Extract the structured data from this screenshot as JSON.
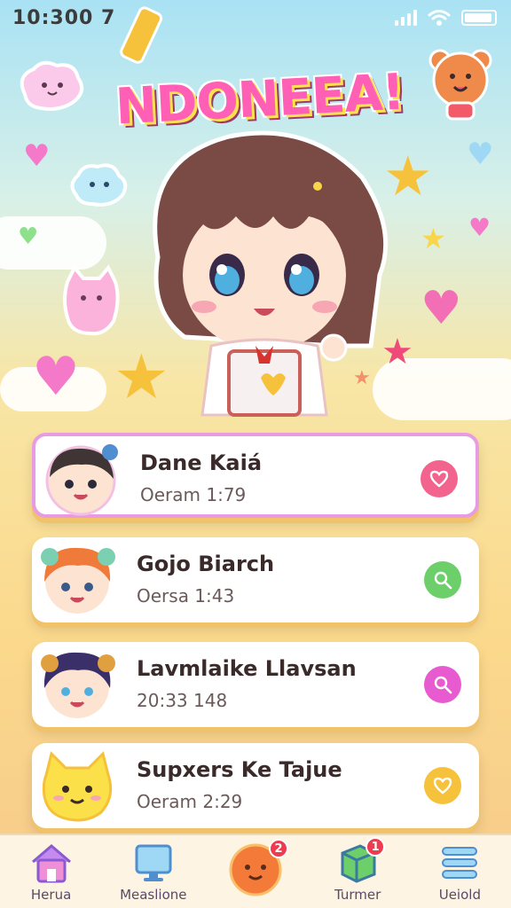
{
  "status": {
    "time": "10:300 7"
  },
  "hero": {
    "title": "NDONEEA!"
  },
  "colors": {
    "pink": "#ff5fb4",
    "green": "#6ccf6a",
    "magenta": "#e85bd0",
    "yellow": "#f7c23b"
  },
  "cards": [
    {
      "name": "Dane Kaiá",
      "time": "Oeram 1:79",
      "action_icon": "heart-icon",
      "action_color": "#f2648e"
    },
    {
      "name": "Gojo Biarch",
      "time": "Oersa 1:43",
      "action_icon": "search-icon",
      "action_color": "#6ccf6a"
    },
    {
      "name": "Lavmlaike Llavsan",
      "time": "20:33 148",
      "action_icon": "search-icon",
      "action_color": "#e85bd0"
    },
    {
      "name": "Supxers Ke Tajue",
      "time": "Oeram 2:29",
      "action_icon": "heart-icon",
      "action_color": "#f7c23b"
    }
  ],
  "nav": {
    "items": [
      {
        "label": "Herua",
        "icon": "home-icon"
      },
      {
        "label": "Measlione",
        "icon": "monitor-icon"
      },
      {
        "label": "",
        "icon": "face-icon",
        "badge": "2"
      },
      {
        "label": "Turmer",
        "icon": "cube-icon",
        "badge": "1"
      },
      {
        "label": "Ueiold",
        "icon": "menu-icon"
      }
    ]
  }
}
